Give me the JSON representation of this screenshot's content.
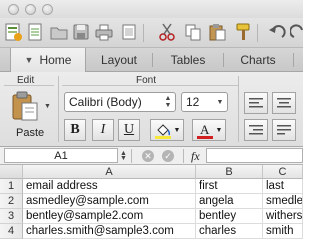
{
  "ribbon_tabs": [
    "Home",
    "Layout",
    "Tables",
    "Charts"
  ],
  "groups": {
    "edit": "Edit",
    "font": "Font"
  },
  "paste_label": "Paste",
  "font_name": "Calibri (Body)",
  "font_size": "12",
  "format_buttons": {
    "bold": "B",
    "italic": "I",
    "underline": "U"
  },
  "formula_bar": {
    "cell_ref": "A1",
    "fx": "fx",
    "value": ""
  },
  "columns": [
    "A",
    "B",
    "C"
  ],
  "row_numbers": [
    "1",
    "2",
    "3",
    "4"
  ],
  "rows": [
    [
      "email address",
      "first",
      "last"
    ],
    [
      "asmedley@sample.com",
      "angela",
      "smedley"
    ],
    [
      "bentley@sample2.com",
      "bentley",
      "withers"
    ],
    [
      "charles.smith@sample3.com",
      "charles",
      "smith"
    ]
  ],
  "colors": {
    "fill_color": "#f6e93a",
    "font_color": "#d21f1f"
  }
}
